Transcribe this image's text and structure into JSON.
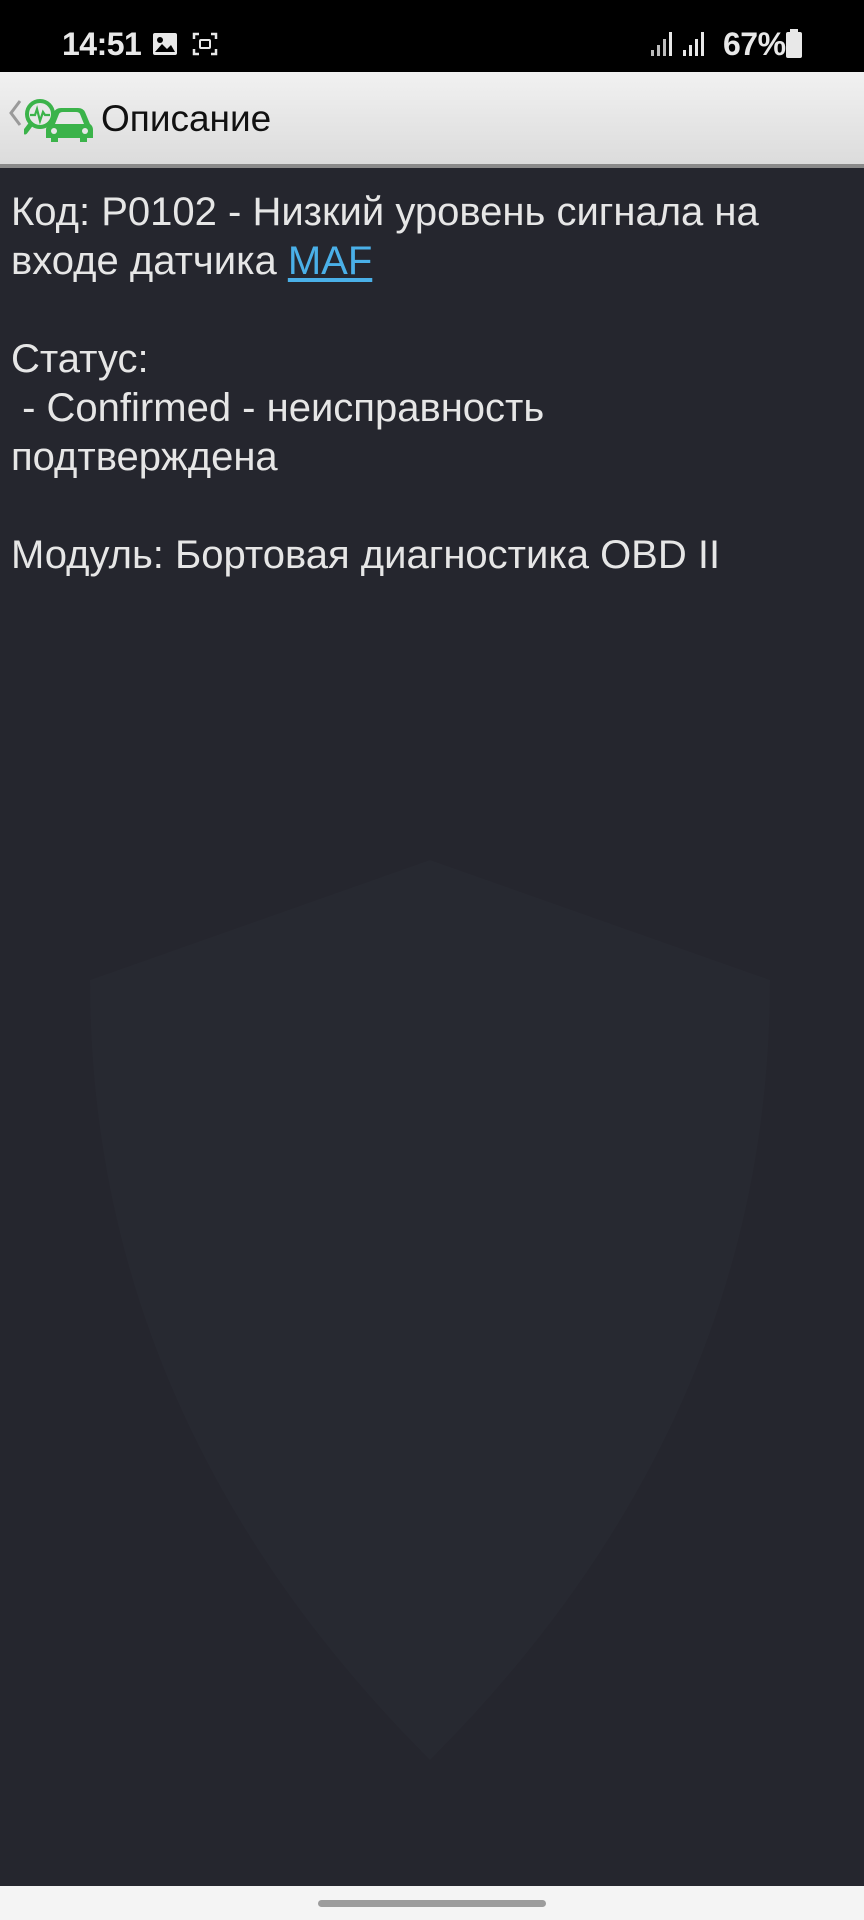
{
  "status_bar": {
    "time": "14:51",
    "battery": "67%",
    "icons": [
      "image-icon",
      "screenshot-icon",
      "signal-1-icon",
      "signal-2-icon",
      "battery-icon"
    ]
  },
  "app_bar": {
    "title": "Описание",
    "icons": [
      "back-chevron-icon",
      "car-diagnostic-logo-icon"
    ],
    "logo_color": "#3bb34a"
  },
  "content": {
    "code_line1": "Код: P0102 - Низкий уровень сигнала на",
    "code_line2_prefix": "входе датчика ",
    "code_link": "MAF",
    "status_label": "Статус:",
    "status_line1": " - Confirmed - неисправность",
    "status_line2": "подтверждена",
    "module": "Модуль: Бортовая диагностика OBD II",
    "link_color": "#4ab0e8",
    "text_color": "#e6e6e6",
    "background": "#25262e"
  }
}
